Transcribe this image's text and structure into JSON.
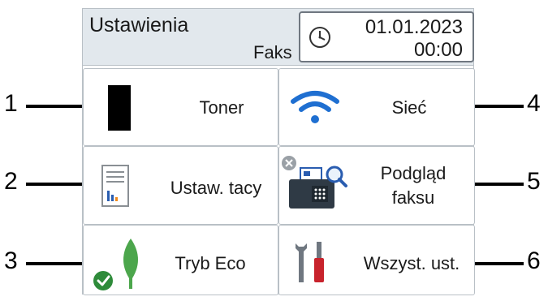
{
  "header": {
    "title": "Ustawienia",
    "subtitle": "Faks",
    "date": "01.01.2023",
    "time": "00:00"
  },
  "tiles": [
    {
      "label": "Toner",
      "icon": "toner-cartridge-icon"
    },
    {
      "label": "Sieć",
      "icon": "wifi-icon"
    },
    {
      "label": "Ustaw. tacy",
      "icon": "tray-settings-icon"
    },
    {
      "label_line1": "Podgląd",
      "label_line2": "faksu",
      "icon": "fax-preview-icon"
    },
    {
      "label": "Tryb Eco",
      "icon": "eco-leaf-icon"
    },
    {
      "label": "Wszyst. ust.",
      "icon": "tools-icon"
    }
  ],
  "callouts": [
    "1",
    "2",
    "3",
    "4",
    "5",
    "6"
  ],
  "colors": {
    "header_bg": "#e2e8ed",
    "border": "#b9c0c6",
    "wifi_blue": "#1f6fd1",
    "leaf_green": "#4ca64c",
    "check_green": "#2e8b3a",
    "screwdriver_red": "#c8232c",
    "chart_orange": "#f08a1c",
    "chart_blue": "#2a5db0"
  }
}
